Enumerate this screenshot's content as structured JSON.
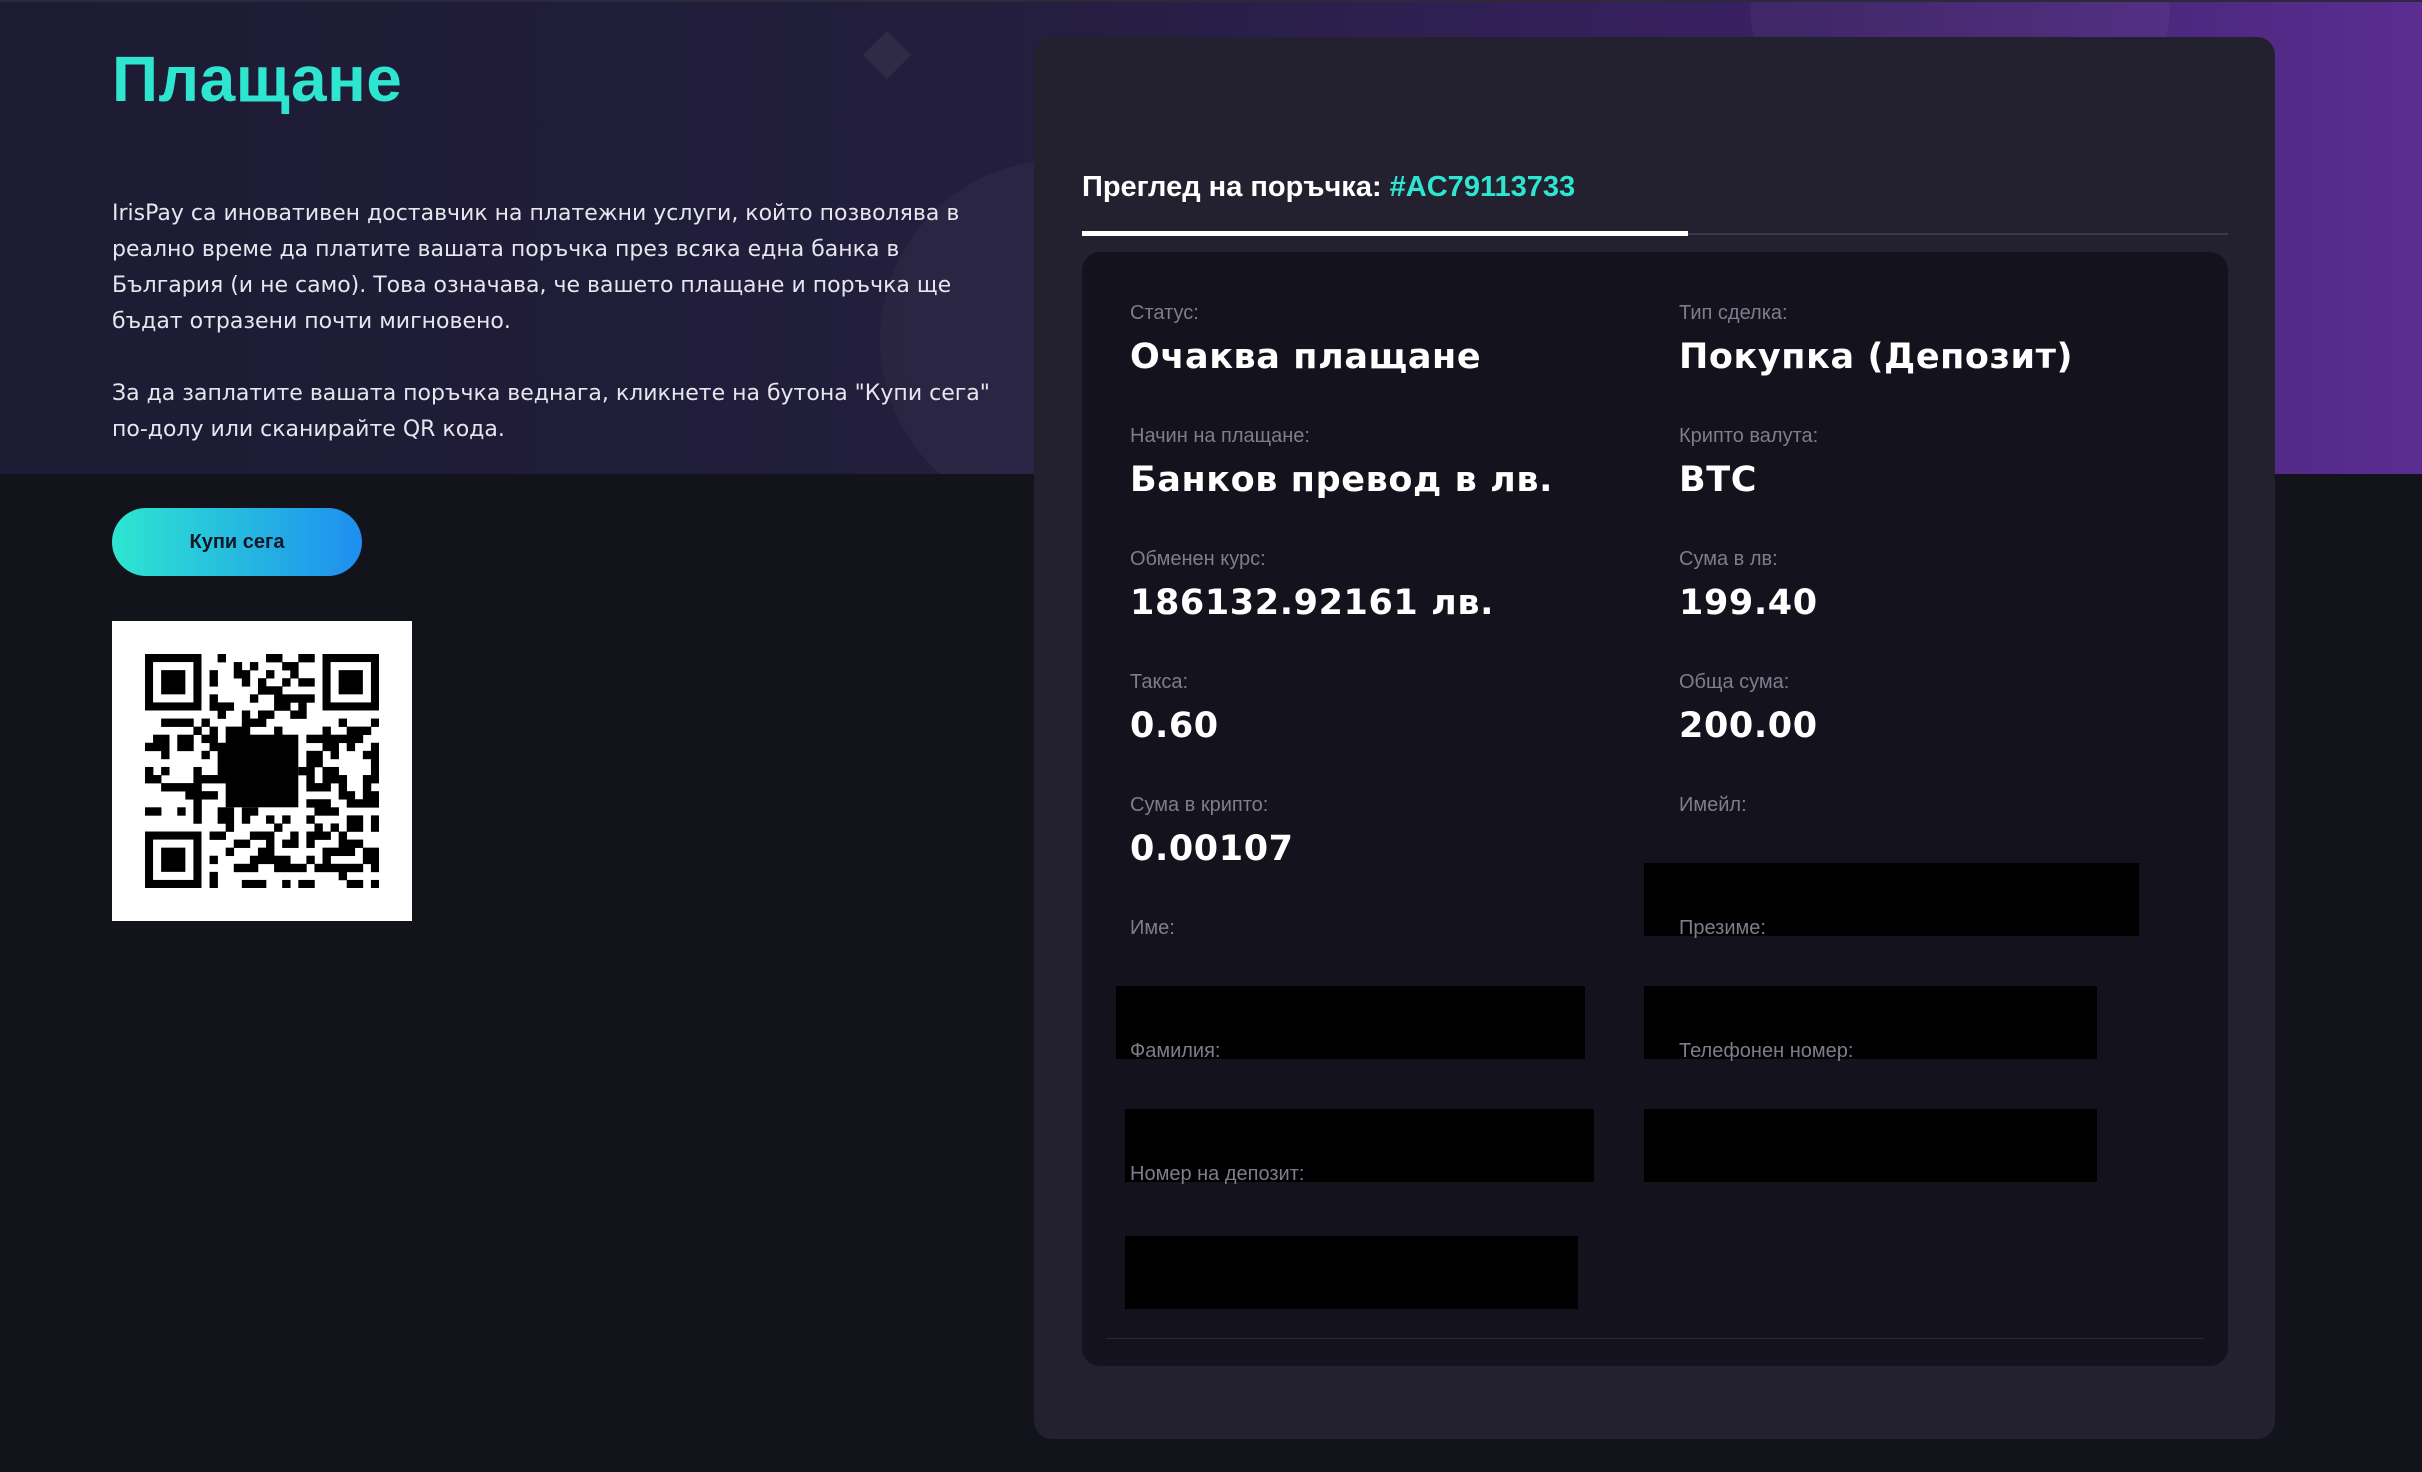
{
  "page": {
    "title": "Плащане",
    "description_1": "IrisPay са иновативен доставчик на платежни услуги, който позволява в реално време да платите вашата поръчка през всяка една банка в България (и не само). Това означава, че вашето плащане и поръчка ще бъдат отразени почти мигновено.",
    "description_2": "За да заплатите вашата поръчка веднага, кликнете на бутона \"Купи сега\" по-долу или сканирайте QR кода.",
    "buy_button": "Купи сега"
  },
  "order": {
    "tab_label": "Преглед на поръчка:",
    "order_id": "#AC79113733",
    "fields": {
      "status_label": "Статус:",
      "status_value": "Очаква плащане",
      "deal_type_label": "Тип сделка:",
      "deal_type_value": "Покупка (Депозит)",
      "payment_method_label": "Начин на плащане:",
      "payment_method_value": "Банков превод в лв.",
      "crypto_label": "Крипто валута:",
      "crypto_value": "BTC",
      "rate_label": "Обменен курс:",
      "rate_value": "186132.92161 лв.",
      "amount_bgn_label": "Сума в лв:",
      "amount_bgn_value": "199.40",
      "fee_label": "Такса:",
      "fee_value": "0.60",
      "total_label": "Обща сума:",
      "total_value": "200.00",
      "crypto_amount_label": "Сума в крипто:",
      "crypto_amount_value": "0.00107",
      "email_label": "Имейл:",
      "first_name_label": "Име:",
      "middle_name_label": "Презиме:",
      "last_name_label": "Фамилия:",
      "phone_label": "Телефонен номер:",
      "deposit_number_label": "Номер на депозит:"
    }
  },
  "colors": {
    "accent": "#2ee6d0",
    "button_gradient_end": "#1e8ef0",
    "background": "#13131c",
    "card": "#23212f",
    "inner_card": "#14131d"
  },
  "icons": {
    "qr": "qr-code-image"
  }
}
